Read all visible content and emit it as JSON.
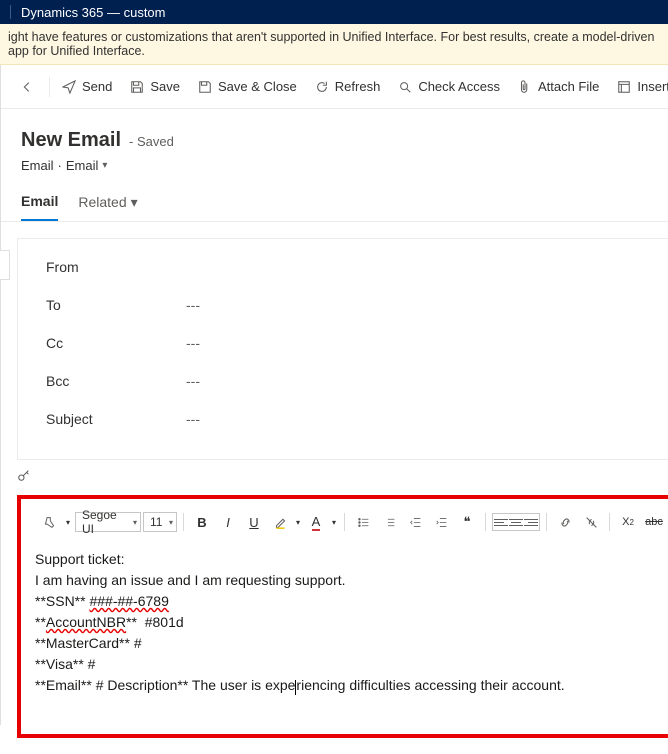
{
  "topbar": {
    "title": "Dynamics 365 — custom"
  },
  "warning": {
    "text": "ight have features or customizations that aren't supported in Unified Interface. For best results, create a model-driven app for Unified Interface."
  },
  "commands": {
    "send": "Send",
    "save": "Save",
    "saveClose": "Save & Close",
    "refresh": "Refresh",
    "checkAccess": "Check Access",
    "attach": "Attach File",
    "insertTemplate": "Insert Templat"
  },
  "header": {
    "title": "New Email",
    "subtitle": "- Saved",
    "crumb1": "Email",
    "crumbSep": "·",
    "crumb2": "Email"
  },
  "tabs": {
    "email": "Email",
    "related": "Related"
  },
  "fields": {
    "from": {
      "label": "From",
      "value": ""
    },
    "to": {
      "label": "To",
      "value": "---"
    },
    "cc": {
      "label": "Cc",
      "value": "---"
    },
    "bcc": {
      "label": "Bcc",
      "value": "---"
    },
    "subject": {
      "label": "Subject",
      "value": "---"
    }
  },
  "rte": {
    "font": "Segoe UI",
    "size": "11"
  },
  "body": {
    "l1": "Support ticket:",
    "l2": "I am having an issue and I am requesting support.",
    "l3a": "**SSN** ",
    "l3b": "###-##-6789",
    "l4a": "**",
    "l4b": "AccountNBR",
    "l4c": "**  #801d",
    "l5": "**MasterCard** #",
    "l6": "**Visa** #",
    "l7a": "**Email** # Description** The user is expe",
    "l7b": "riencing difficulties accessing their account."
  }
}
